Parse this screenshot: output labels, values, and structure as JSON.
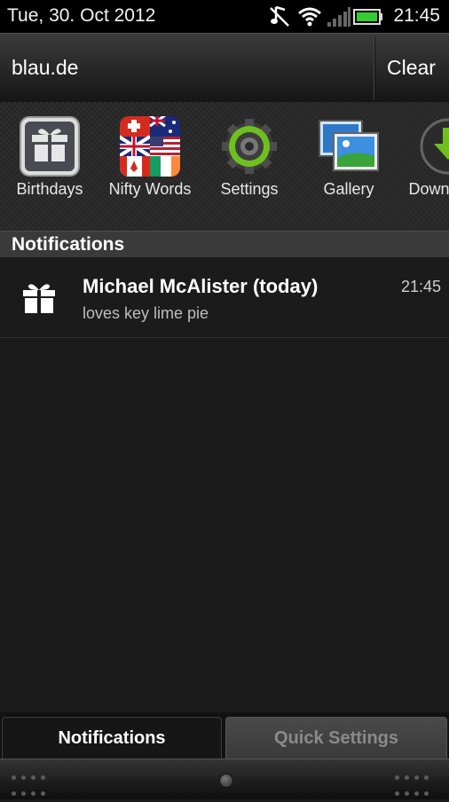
{
  "status_bar": {
    "date": "Tue, 30. Oct 2012",
    "time": "21:45",
    "icons": [
      "music-off-icon",
      "wifi-icon",
      "signal-icon",
      "battery-icon"
    ],
    "battery_color": "#33cc33"
  },
  "header": {
    "carrier": "blau.de",
    "clear_label": "Clear"
  },
  "recent_apps": [
    {
      "label": "Birthdays",
      "icon": "gift-icon"
    },
    {
      "label": "Nifty Words",
      "icon": "flags-icon"
    },
    {
      "label": "Settings",
      "icon": "gear-icon"
    },
    {
      "label": "Gallery",
      "icon": "gallery-icon"
    },
    {
      "label": "Downloads",
      "icon": "download-icon"
    }
  ],
  "notifications_section": {
    "title": "Notifications",
    "items": [
      {
        "title": "Michael McAlister (today)",
        "subtitle": "loves key lime pie",
        "time": "21:45",
        "icon": "gift-icon"
      }
    ]
  },
  "tabs": [
    {
      "label": "Notifications",
      "active": true
    },
    {
      "label": "Quick Settings",
      "active": false
    }
  ],
  "colors": {
    "background": "#1b1b1b",
    "section_header": "#3a3a3a",
    "accent_green": "#6fbf1f"
  }
}
